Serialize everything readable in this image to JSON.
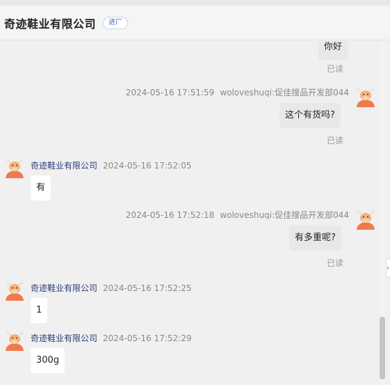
{
  "header": {
    "company_name": "奇迹鞋业有限公司",
    "badge": "进厂"
  },
  "messages": {
    "m0": {
      "text": "你好",
      "read": "已读"
    },
    "m1": {
      "time": "2024-05-16 17:51:59",
      "sender": "woloveshuqi:促佳搜品开发部044",
      "text": "这个有货吗?",
      "read": "已读"
    },
    "m2": {
      "sender": "奇迹鞋业有限公司",
      "time": "2024-05-16 17:52:05",
      "text": "有"
    },
    "m3": {
      "time": "2024-05-16 17:52:18",
      "sender": "woloveshuqi:促佳搜品开发部044",
      "text": "有多重呢?",
      "read": "已读"
    },
    "m4": {
      "sender": "奇迹鞋业有限公司",
      "time": "2024-05-16 17:52:25",
      "text": "1"
    },
    "m5": {
      "sender": "奇迹鞋业有限公司",
      "time": "2024-05-16 17:52:29",
      "text": "300g"
    }
  },
  "side_tab": {
    "icon": "chevron-right-icon"
  },
  "colors": {
    "bubble_incoming": "#ffffff",
    "bubble_outgoing": "#e8e8e8",
    "sender_name": "#2d3a7a",
    "badge": "#3a6fd8"
  }
}
